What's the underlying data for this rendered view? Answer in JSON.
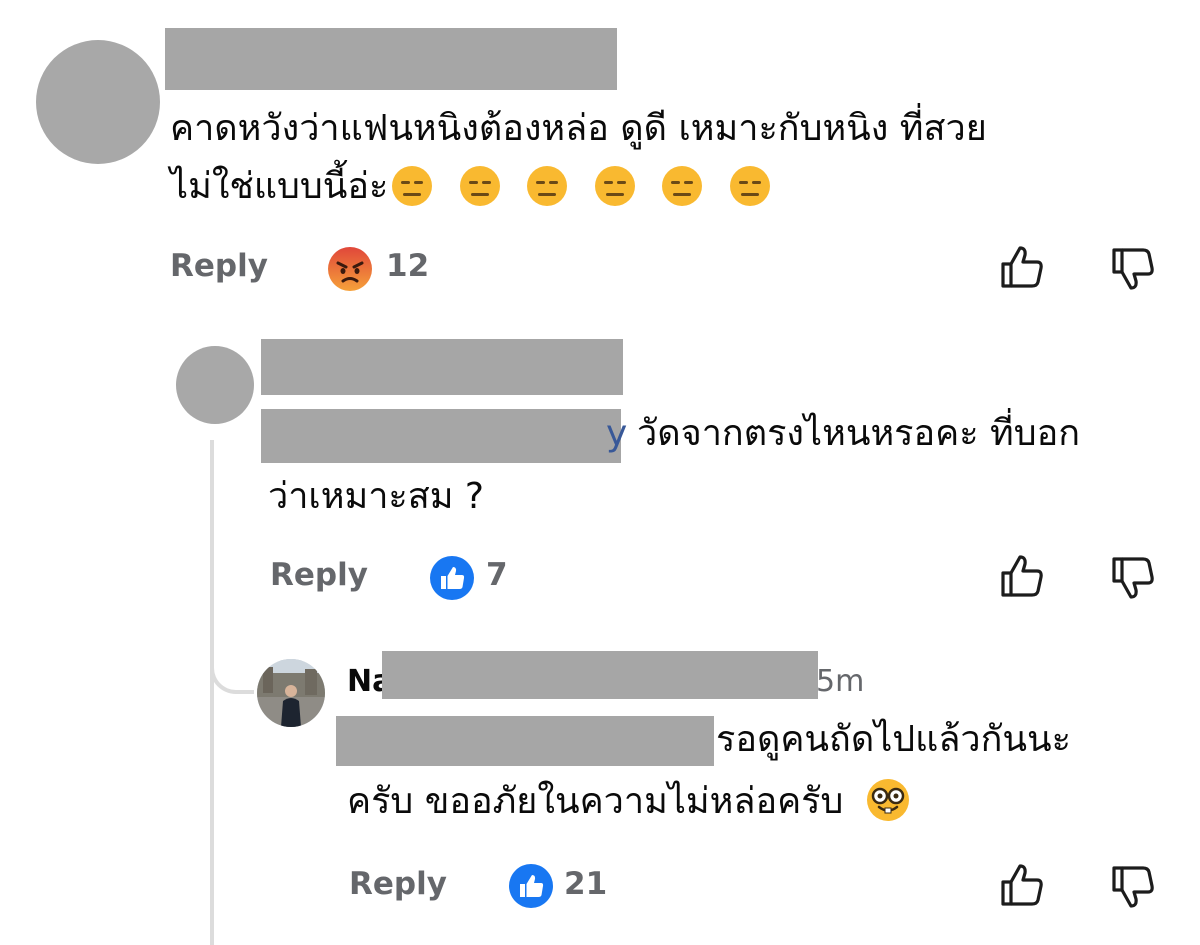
{
  "comments": [
    {
      "text_line1": "คาดหวังว่าแฟนหนิงต้องหล่อ ดูดี เหมาะกับหนิง ที่สวย",
      "text_line2": "ไม่ใช่แบบนี้อ่ะ",
      "emoji_inline": [
        "expressionless-emoji",
        "expressionless-emoji",
        "expressionless-emoji",
        "expressionless-emoji",
        "expressionless-emoji",
        "expressionless-emoji"
      ],
      "reply_label": "Reply",
      "reaction_icon": "angry-face-icon",
      "reaction_count": "12"
    },
    {
      "text_line1": "วัดจากตรงไหนหรอคะ ที่บอก",
      "text_line2": "ว่าเหมาะสม ?",
      "mention_tail": "y",
      "reply_label": "Reply",
      "reaction_icon": "like-icon",
      "reaction_count": "7"
    },
    {
      "author_prefix": "Na",
      "time": "5m",
      "text_line1": "รอดูคนถัดไปแล้วกันนะ",
      "text_line2": "ครับ ขออภัยในความไม่หล่อครับ",
      "emoji_trailing": "nerd-face-emoji",
      "reply_label": "Reply",
      "reaction_icon": "like-icon",
      "reaction_count": "21"
    }
  ],
  "colors": {
    "like_blue": "#1877f2",
    "angry_red": "#e9573f",
    "muted_text": "#65676b",
    "redaction": "#a6a6a6",
    "mention_blue": "#385898"
  }
}
